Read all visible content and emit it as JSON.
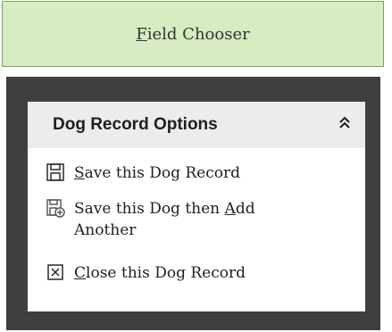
{
  "field_chooser": {
    "label_accel": "F",
    "label_rest": "ield Chooser"
  },
  "panel": {
    "title": "Dog Record Options",
    "collapse_icon": "double-chevron-up-icon",
    "items": [
      {
        "icon": "floppy-disk-icon",
        "accel": "S",
        "rest": "ave this Dog Record"
      },
      {
        "icon": "save-and-add-icon",
        "line1_pre": "Save this Dog then ",
        "line1_accel": "A",
        "line1_post": "dd",
        "line2": "Another"
      },
      {
        "icon": "close-box-icon",
        "accel": "C",
        "rest": "lose this Dog Record"
      }
    ]
  },
  "colors": {
    "field_chooser_bg": "#d8ecc3",
    "field_chooser_border": "#7da356",
    "dark_area": "#3f3f3f",
    "panel_header_bg": "#ececec"
  }
}
